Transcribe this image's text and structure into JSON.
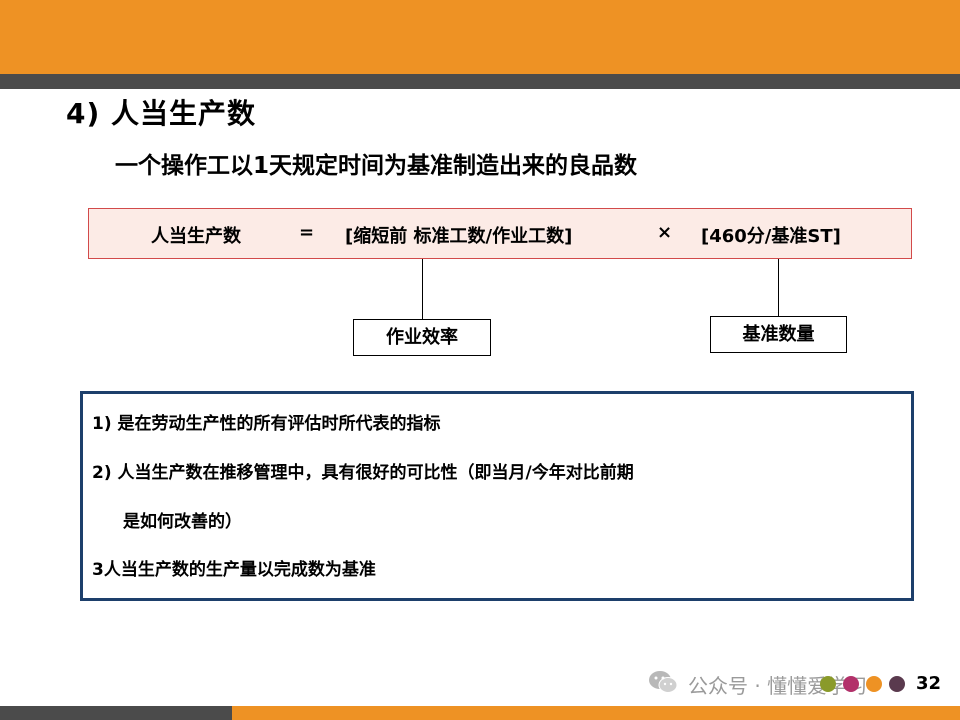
{
  "heading": "4) 人当生产数",
  "subheading": "一个操作工以1天规定时间为基准制造出来的良品数",
  "formula": {
    "lhs": "人当生产数",
    "equals": "=",
    "part1": "[缩短前 标准工数/作业工数]",
    "times": "×",
    "part2": "[460分/基准ST]"
  },
  "labels": {
    "efficiency": "作业效率",
    "quantity": "基准数量"
  },
  "notes": [
    "1) 是在劳动生产性的所有评估时所代表的指标",
    "2) 人当生产数在推移管理中，具有很好的可比性（即当月/今年对比前期",
    "是如何改善的）",
    "3人当生产数的生产量以完成数为基准"
  ],
  "footer": {
    "watermark": "公众号 · 懂懂爱学习",
    "page_number": "32",
    "dot_colors": [
      "#8a9a2a",
      "#b2316a",
      "#ee9224",
      "#5a3a4e"
    ]
  },
  "colors": {
    "accent_orange": "#ee9224",
    "stripe_gray": "#4b4b4b",
    "formula_fill": "#fcebe6",
    "formula_border": "#d24a4a",
    "notes_border": "#1d3f6b"
  }
}
